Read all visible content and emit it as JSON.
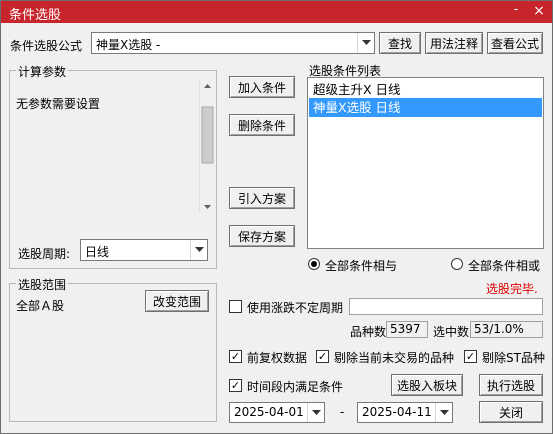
{
  "window": {
    "title": "条件选股",
    "minimize": "-",
    "close": "×"
  },
  "formula": {
    "label": "条件选股公式",
    "value": "神量X选股    -",
    "find": "查找",
    "usage": "用法注释",
    "view": "查看公式"
  },
  "params": {
    "title": "计算参数",
    "text": "无参数需要设置"
  },
  "period": {
    "label": "选股周期:",
    "value": "日线"
  },
  "range": {
    "title": "选股范围",
    "value": "全部Ａ股",
    "change": "改变范围"
  },
  "actions": {
    "add": "加入条件",
    "delete": "删除条件",
    "import": "引入方案",
    "save": "保存方案"
  },
  "conditions": {
    "title": "选股条件列表",
    "items": [
      {
        "label": "超级主升X  日线",
        "selected": false
      },
      {
        "label": "神量X选股  日线",
        "selected": true
      }
    ]
  },
  "logic": {
    "and_label": "全部条件相与",
    "or_label": "全部条件相或",
    "status": "选股完毕."
  },
  "variable_period": {
    "label": "使用涨跌不定周期",
    "value": ""
  },
  "counts": {
    "total_label": "品种数",
    "total_value": "5397",
    "selected_label": "选中数",
    "selected_value": "53/1.0%"
  },
  "options": {
    "fq": "前复权数据",
    "exclude_notrade": "剔除当前未交易的品种",
    "exclude_st": "剔除ST品种",
    "time_range": "时间段内满足条件"
  },
  "buttons": {
    "to_block": "选股入板块",
    "execute": "执行选股",
    "close": "关闭"
  },
  "dates": {
    "start": "2025-04-01",
    "separator": "-",
    "end": "2025-04-11"
  }
}
